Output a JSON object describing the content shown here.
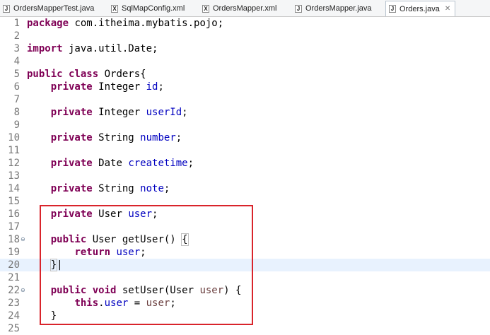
{
  "tabs": [
    {
      "label": "OrdersMapperTest.java",
      "icon": "J",
      "active": false
    },
    {
      "label": "SqlMapConfig.xml",
      "icon": "X",
      "active": false
    },
    {
      "label": "OrdersMapper.xml",
      "icon": "X",
      "active": false
    },
    {
      "label": "OrdersMapper.java",
      "icon": "J",
      "active": false
    },
    {
      "label": "Orders.java",
      "icon": "J",
      "active": true
    }
  ],
  "close_glyph": "✕",
  "lines": [
    {
      "num": "1",
      "tokens": [
        [
          "kw",
          "package"
        ],
        [
          "t",
          " com.itheima.mybatis.pojo;"
        ]
      ]
    },
    {
      "num": "2",
      "tokens": []
    },
    {
      "num": "3",
      "tokens": [
        [
          "kw",
          "import"
        ],
        [
          "t",
          " java.util.Date;"
        ]
      ]
    },
    {
      "num": "4",
      "tokens": []
    },
    {
      "num": "5",
      "tokens": [
        [
          "kw",
          "public class"
        ],
        [
          "t",
          " Orders{"
        ]
      ]
    },
    {
      "num": "6",
      "tokens": [
        [
          "t",
          "    "
        ],
        [
          "kw",
          "private"
        ],
        [
          "t",
          " Integer "
        ],
        [
          "fd",
          "id"
        ],
        [
          "t",
          ";"
        ]
      ]
    },
    {
      "num": "7",
      "tokens": []
    },
    {
      "num": "8",
      "tokens": [
        [
          "t",
          "    "
        ],
        [
          "kw",
          "private"
        ],
        [
          "t",
          " Integer "
        ],
        [
          "fd",
          "userId"
        ],
        [
          "t",
          ";"
        ]
      ]
    },
    {
      "num": "9",
      "tokens": []
    },
    {
      "num": "10",
      "tokens": [
        [
          "t",
          "    "
        ],
        [
          "kw",
          "private"
        ],
        [
          "t",
          " String "
        ],
        [
          "fd",
          "number"
        ],
        [
          "t",
          ";"
        ]
      ]
    },
    {
      "num": "11",
      "tokens": []
    },
    {
      "num": "12",
      "tokens": [
        [
          "t",
          "    "
        ],
        [
          "kw",
          "private"
        ],
        [
          "t",
          " Date "
        ],
        [
          "fd",
          "createtime"
        ],
        [
          "t",
          ";"
        ]
      ]
    },
    {
      "num": "13",
      "tokens": []
    },
    {
      "num": "14",
      "tokens": [
        [
          "t",
          "    "
        ],
        [
          "kw",
          "private"
        ],
        [
          "t",
          " String "
        ],
        [
          "fd",
          "note"
        ],
        [
          "t",
          ";"
        ]
      ]
    },
    {
      "num": "15",
      "tokens": []
    },
    {
      "num": "16",
      "tokens": [
        [
          "t",
          "    "
        ],
        [
          "kw",
          "private"
        ],
        [
          "t",
          " User "
        ],
        [
          "fd",
          "user"
        ],
        [
          "t",
          ";"
        ]
      ]
    },
    {
      "num": "17",
      "tokens": []
    },
    {
      "num": "18",
      "fold": true,
      "tokens": [
        [
          "t",
          "    "
        ],
        [
          "kw",
          "public"
        ],
        [
          "t",
          " User getUser() "
        ],
        [
          "bm",
          "{"
        ]
      ]
    },
    {
      "num": "19",
      "tokens": [
        [
          "t",
          "        "
        ],
        [
          "kw",
          "return"
        ],
        [
          "t",
          " "
        ],
        [
          "fd",
          "user"
        ],
        [
          "t",
          ";"
        ]
      ]
    },
    {
      "num": "20",
      "current": true,
      "tokens": [
        [
          "t",
          "    "
        ],
        [
          "bm",
          "}"
        ],
        [
          "t",
          "|"
        ]
      ]
    },
    {
      "num": "21",
      "tokens": []
    },
    {
      "num": "22",
      "fold": true,
      "tokens": [
        [
          "t",
          "    "
        ],
        [
          "kw",
          "public void"
        ],
        [
          "t",
          " setUser(User "
        ],
        [
          "par",
          "user"
        ],
        [
          "t",
          ") {"
        ]
      ]
    },
    {
      "num": "23",
      "tokens": [
        [
          "t",
          "        "
        ],
        [
          "kw",
          "this"
        ],
        [
          "t",
          "."
        ],
        [
          "fd",
          "user"
        ],
        [
          "t",
          " = "
        ],
        [
          "par",
          "user"
        ],
        [
          "t",
          ";"
        ]
      ]
    },
    {
      "num": "24",
      "tokens": [
        [
          "t",
          "    }"
        ]
      ]
    },
    {
      "num": "25",
      "tokens": []
    }
  ]
}
